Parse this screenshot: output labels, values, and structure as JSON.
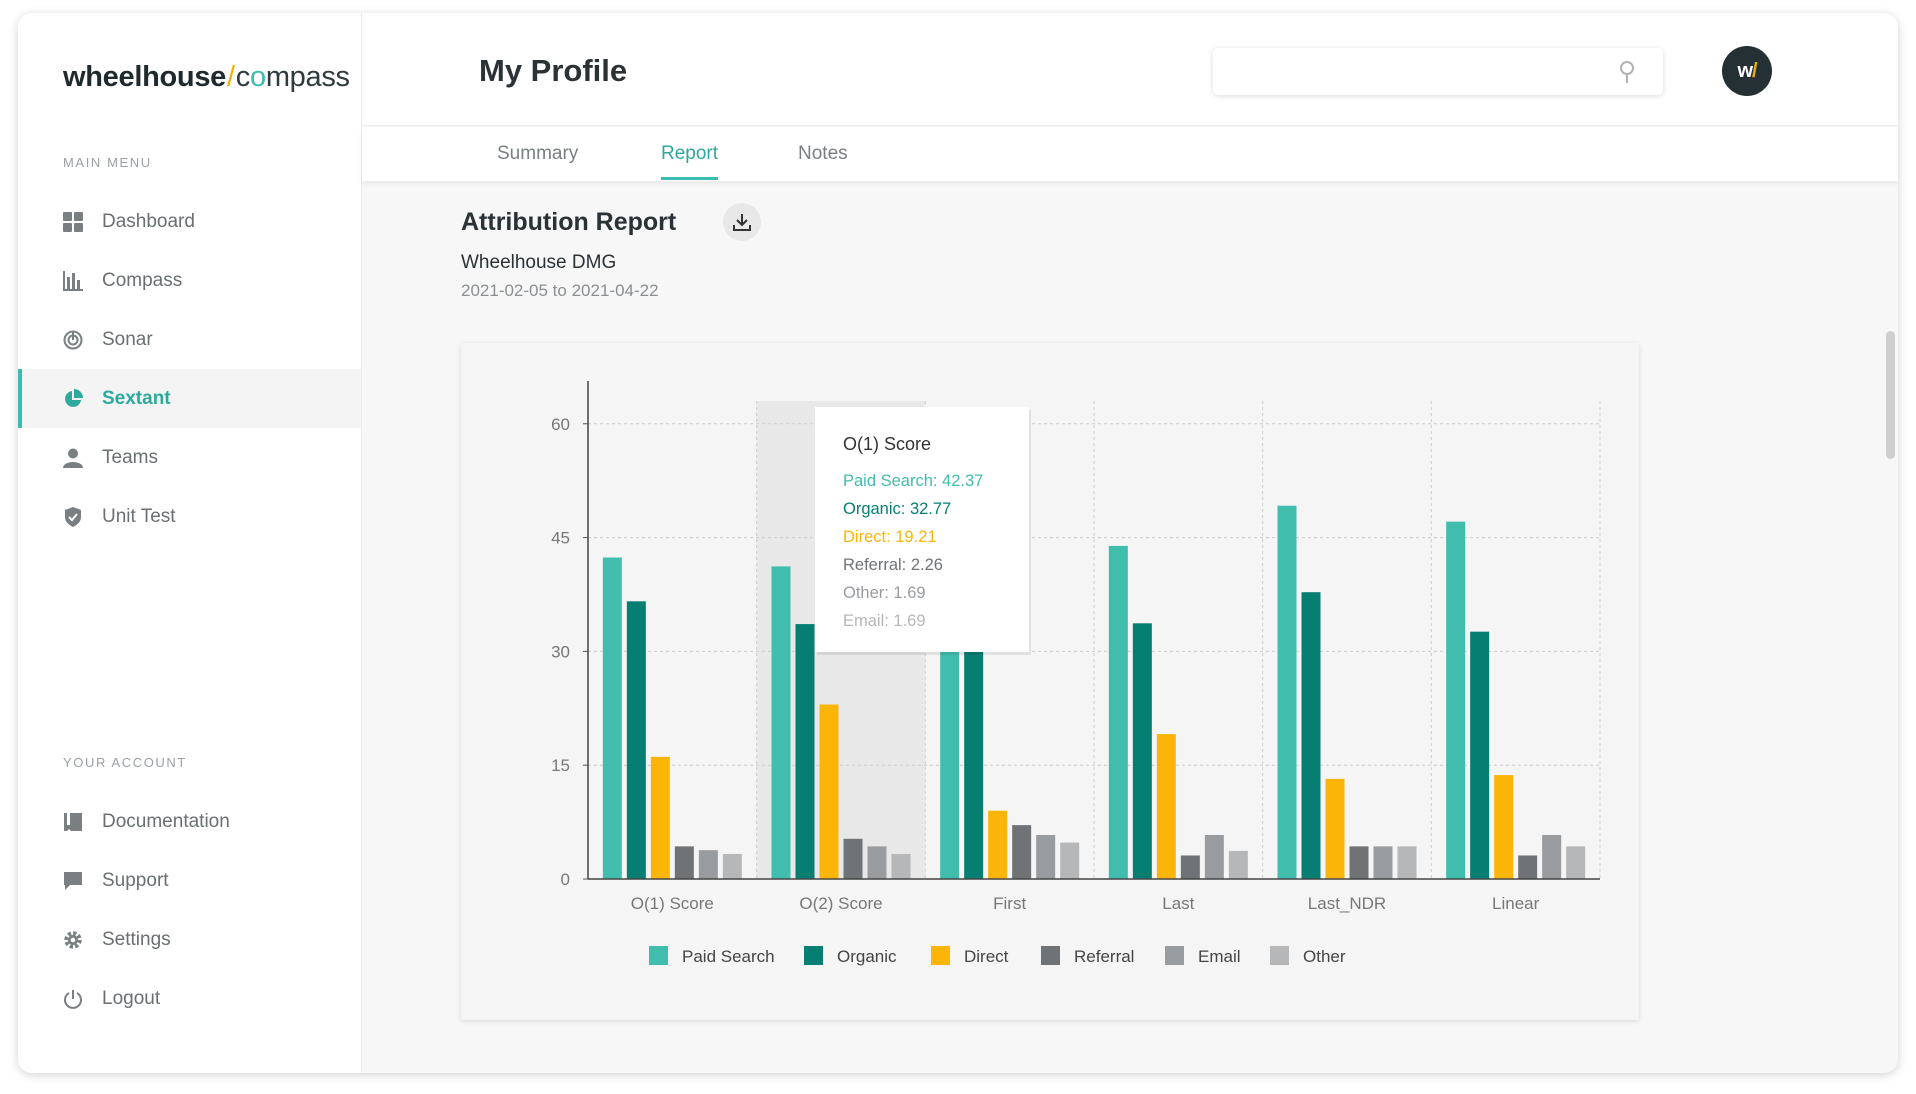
{
  "logo": {
    "wheel": "wheelhouse",
    "slash": "/",
    "c": "c",
    "o": "o",
    "mpass": "mpass"
  },
  "sidebar": {
    "main_menu_label": "MAIN MENU",
    "account_label": "YOUR ACCOUNT",
    "items": [
      {
        "label": "Dashboard",
        "icon": "dashboard-icon"
      },
      {
        "label": "Compass",
        "icon": "bar-chart-icon"
      },
      {
        "label": "Sonar",
        "icon": "sonar-icon"
      },
      {
        "label": "Sextant",
        "icon": "pie-chart-icon"
      },
      {
        "label": "Teams",
        "icon": "user-icon"
      },
      {
        "label": "Unit Test",
        "icon": "shield-icon"
      }
    ],
    "account_items": [
      {
        "label": "Documentation",
        "icon": "book-icon"
      },
      {
        "label": "Support",
        "icon": "chat-icon"
      },
      {
        "label": "Settings",
        "icon": "gear-icon"
      },
      {
        "label": "Logout",
        "icon": "power-icon"
      }
    ],
    "active": "Sextant"
  },
  "header": {
    "title": "My Profile",
    "search_placeholder": "",
    "avatar_w": "w",
    "avatar_slash": "/"
  },
  "tabs": {
    "items": [
      "Summary",
      "Report",
      "Notes"
    ],
    "active": "Report"
  },
  "report": {
    "title": "Attribution Report",
    "company": "Wheelhouse DMG",
    "daterange": "2021-02-05 to 2021-04-22"
  },
  "colors": {
    "accent": "#3cbcb0",
    "paid_search": "#41bdae",
    "organic": "#067f72",
    "direct": "#fbb508",
    "referral": "#6f7376",
    "email": "#999c9f",
    "other": "#b5b7b9"
  },
  "chart_data": {
    "type": "bar",
    "categories": [
      "O(1) Score",
      "O(2) Score",
      "First",
      "Last",
      "Last_NDR",
      "Linear"
    ],
    "yticks": [
      "0",
      "15",
      "30",
      "45",
      "60"
    ],
    "ylim": [
      0,
      63
    ],
    "legend_position": "bottom",
    "series": [
      {
        "name": "Paid Search",
        "color": "#41bdae",
        "values": [
          42.37,
          41.2,
          30.0,
          43.9,
          49.2,
          47.1
        ]
      },
      {
        "name": "Organic",
        "color": "#067f72",
        "values": [
          36.6,
          33.6,
          30.0,
          33.7,
          37.8,
          32.6
        ]
      },
      {
        "name": "Direct",
        "color": "#fbb508",
        "values": [
          16.1,
          23.0,
          9.0,
          19.1,
          13.2,
          13.7
        ]
      },
      {
        "name": "Referral",
        "color": "#6f7376",
        "values": [
          4.3,
          5.3,
          7.1,
          3.1,
          4.3,
          3.1
        ]
      },
      {
        "name": "Email",
        "color": "#999c9f",
        "values": [
          3.8,
          4.3,
          5.8,
          5.8,
          4.3,
          5.8
        ]
      },
      {
        "name": "Other",
        "color": "#b5b7b9",
        "values": [
          3.3,
          3.3,
          4.8,
          3.7,
          4.3,
          4.3
        ]
      }
    ],
    "highlighted_category": "O(2) Score",
    "tooltip": {
      "title": "O(1) Score",
      "lines": [
        {
          "text": "Paid Search: 42.37",
          "color": "#41bdae"
        },
        {
          "text": "Organic: 32.77",
          "color": "#067f72"
        },
        {
          "text": "Direct: 19.21",
          "color": "#fbb508"
        },
        {
          "text": "Referral: 2.26",
          "color": "#6f7376"
        },
        {
          "text": "Other: 1.69",
          "color": "#999c9f"
        },
        {
          "text": "Email: 1.69",
          "color": "#b5b7b9"
        }
      ]
    }
  }
}
